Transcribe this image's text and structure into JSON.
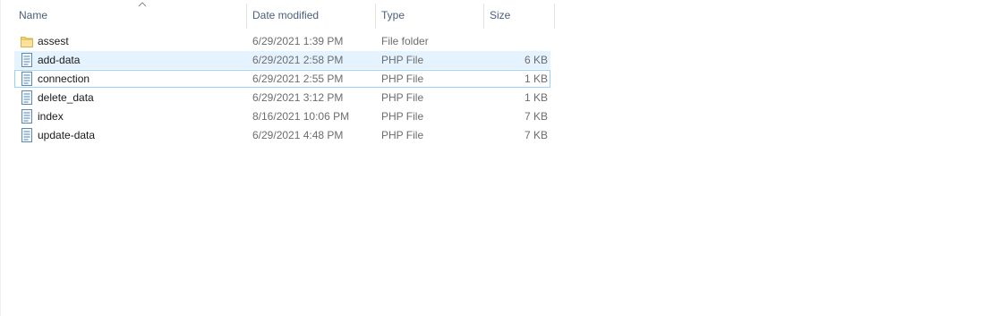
{
  "columns": {
    "name": "Name",
    "date_modified": "Date modified",
    "type": "Type",
    "size": "Size"
  },
  "sort_indicator": "chevron-up-icon",
  "files": [
    {
      "name": "assest",
      "date": "6/29/2021 1:39 PM",
      "type": "File folder",
      "size": "",
      "icon": "folder-icon",
      "state": "normal"
    },
    {
      "name": "add-data",
      "date": "6/29/2021 2:58 PM",
      "type": "PHP File",
      "size": "6 KB",
      "icon": "php-file-icon",
      "state": "selected"
    },
    {
      "name": "connection",
      "date": "6/29/2021 2:55 PM",
      "type": "PHP File",
      "size": "1 KB",
      "icon": "php-file-icon",
      "state": "focused"
    },
    {
      "name": "delete_data",
      "date": "6/29/2021 3:12 PM",
      "type": "PHP File",
      "size": "1 KB",
      "icon": "php-file-icon",
      "state": "normal"
    },
    {
      "name": "index",
      "date": "8/16/2021 10:06 PM",
      "type": "PHP File",
      "size": "7 KB",
      "icon": "php-file-icon",
      "state": "normal"
    },
    {
      "name": "update-data",
      "date": "6/29/2021 4:48 PM",
      "type": "PHP File",
      "size": "7 KB",
      "icon": "php-file-icon",
      "state": "normal"
    }
  ],
  "colors": {
    "header_text": "#4c607a",
    "selection_bg": "#e5f3ff",
    "focus_border": "#99d1ff",
    "folder": "#f8d775"
  }
}
